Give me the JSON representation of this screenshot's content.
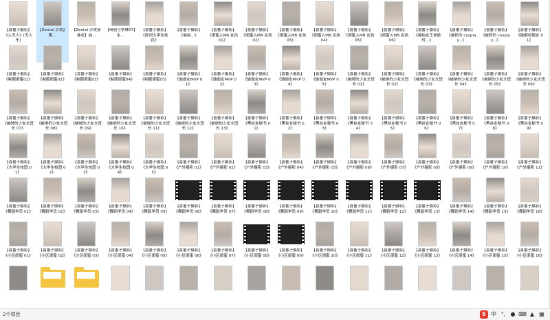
{
  "colors": {
    "accent": "#0078d4",
    "selection": "#cce8ff",
    "folder": "#f4c542",
    "ime_logo": "#e8342a"
  },
  "status": {
    "count": "2个项目"
  },
  "ime": {
    "logo": "S",
    "lang": "中",
    "punct": "°,",
    "mic": "mic-icon",
    "keyboard": "keyboard-icon",
    "skin": "shirt-icon",
    "grid": "grid-icon"
  },
  "items": [
    "【喜番子摄影】《入无人》[无人车]",
    "【Zentai 沙发】跪...",
    "【Zentai 沙发紧身衣】前...",
    "【喝包小学妹07】生...",
    "【喜番子摄影】《原创大学生校花》",
    "【喜番子摄影】《偷拍...》",
    "【喜番子摄影】《闺蜜入MB 女孩01》",
    "【喜番子摄影】《闺蜜入MB 女孩02》",
    "【喜番子摄影】《闺蜜入MB 女孩03》",
    "【喜番子摄影】《闺蜜入MB 女孩04》",
    "【喜番子摄影】《闺蜜入MB 女孩05》",
    "【喜番子摄影】《闺蜜入MB 女孩06》",
    "【喜番子摄影】《被拍女王单偷时...》",
    "【喜番子摄影】《被抓的 cosplay...》",
    "【喜番子摄影】《被抓的 cosplay...》",
    "【喜番子摄影】《破解校服女 01》",
    "【喜番子摄影】《制服闺蜜01》",
    "【喜番子摄影】《制服闺蜜02》",
    "【喜番子摄影】《制服闺蜜03》",
    "【喜番子摄影】《制服闺蜜04》",
    "【喜番子摄影】《制服闺蜜05》",
    "【喜番子摄影】《瑜伽女MVP 01》",
    "【喜番子摄影】《瑜伽女MVP 02》",
    "【喜番子摄影】《瑜伽女MVP 03》",
    "【喜番子摄影】《瑜伽女MVP 04》",
    "【喜番子摄影】《瑜伽女MVP 05》",
    "【喜番子摄影】《被绑的少女文班长 01》",
    "【喜番子摄影】《被绑的少女文班长 02》",
    "【喜番子摄影】《被绑的少女文班长 03》",
    "【喜番子摄影】《被绑的少女文班长 04》",
    "【喜番子摄影】《被绑的少女文班长 05》",
    "【喜番子摄影】《被绑的少女文班长 06》",
    "【喜番子摄影】《被绑的少女文班长 07》",
    "【喜番子摄影】《被绑的少女文班长 08》",
    "【喜番子摄影】《被绑的少女文班长 09》",
    "【喜番子摄影】《被绑的少女文班长 10》",
    "【喜番子摄影】《被绑的少女文班长 11》",
    "【喜番子摄影】《被绑的少女文班长 12》",
    "【喜番子摄影】《被绑的少女文班长 13》",
    "【喜番子摄影】《黑丝女秘书 01》",
    "【喜番子摄影】《黑丝女秘书 02》",
    "【喜番子摄影】《黑丝女秘书 03》",
    "【喜番子摄影】《黑丝女秘书 04》",
    "【喜番子摄影】《黑丝女秘书 05》",
    "【喜番子摄影】《黑丝女秘书 06》",
    "【喜番子摄影】《黑丝女秘书 07》",
    "【喜番子摄影】《黑丝女秘书 08》",
    "【喜番子摄影】《黑丝女秘书 09》",
    "【喜番子摄影】《大学生校园 01》",
    "【喜番子摄影】《大学生校园 02》",
    "【喜番子摄影】《大学生校园 03》",
    "【喜番子摄影】《大学生校园 04》",
    "【喜番子摄影】《大学生校园 05》",
    "【喜番子摄影】《户外摄影 01》",
    "【喜番子摄影】《户外摄影 02》",
    "【喜番子摄影】《户外摄影 03》",
    "【喜番子摄影】《户外摄影 04》",
    "【喜番子摄影】《户外摄影 05》",
    "【喜番子摄影】《户外摄影 06》",
    "【喜番子摄影】《户外摄影 07》",
    "【喜番子摄影】《户外摄影 08》",
    "【喜番子摄影】《户外摄影 09》",
    "【喜番子摄影】《户外摄影 10》",
    "【喜番子摄影】《户外摄影 11》",
    "【喜番子摄影】《舞蹈学员 01》",
    "【喜番子摄影】《舞蹈学员 02》",
    "【喜番子摄影】《舞蹈学员 03》",
    "【喜番子摄影】《舞蹈学员 04》",
    "【喜番子摄影】《舞蹈学员 05》",
    "【喜番子摄影】《舞蹈学员 06》",
    "【喜番子摄影】《舞蹈学员 07》",
    "【喜番子摄影】《舞蹈学员 08》",
    "【喜番子摄影】《舞蹈学员 09》",
    "【喜番子摄影】《舞蹈学员 10》",
    "【喜番子摄影】《舞蹈学员 11》",
    "【喜番子摄影】《舞蹈学员 12》",
    "【喜番子摄影】《舞蹈学员 13》",
    "【喜番子摄影】《舞蹈学员 14》",
    "【喜番子摄影】《舞蹈学员 15》",
    "【喜番子摄影】《舞蹈学员 16》",
    "【喜番子摄影】《小区闺蜜 01》",
    "【喜番子摄影】《小区闺蜜 02》",
    "【喜番子摄影】《小区闺蜜 03》",
    "【喜番子摄影】《小区闺蜜 04》",
    "【喜番子摄影】《小区闺蜜 05》",
    "【喜番子摄影】《小区闺蜜 06》",
    "【喜番子摄影】《小区闺蜜 07》",
    "【喜番子摄影】《小区闺蜜 08》",
    "【喜番子摄影】《小区闺蜜 09》",
    "【喜番子摄影】《小区闺蜜 10》",
    "【喜番子摄影】《小区闺蜜 11》",
    "【喜番子摄影】《小区闺蜜 12》",
    "【喜番子摄影】《小区闺蜜 13》",
    "【喜番子摄影】《小区闺蜜 14》",
    "【喜番子摄影】《小区闺蜜 15》",
    "【喜番子摄影】《小区闺蜜 16》",
    "",
    "",
    "",
    "",
    "",
    "",
    "",
    "",
    "",
    "",
    "",
    "",
    "",
    "",
    "",
    ""
  ]
}
